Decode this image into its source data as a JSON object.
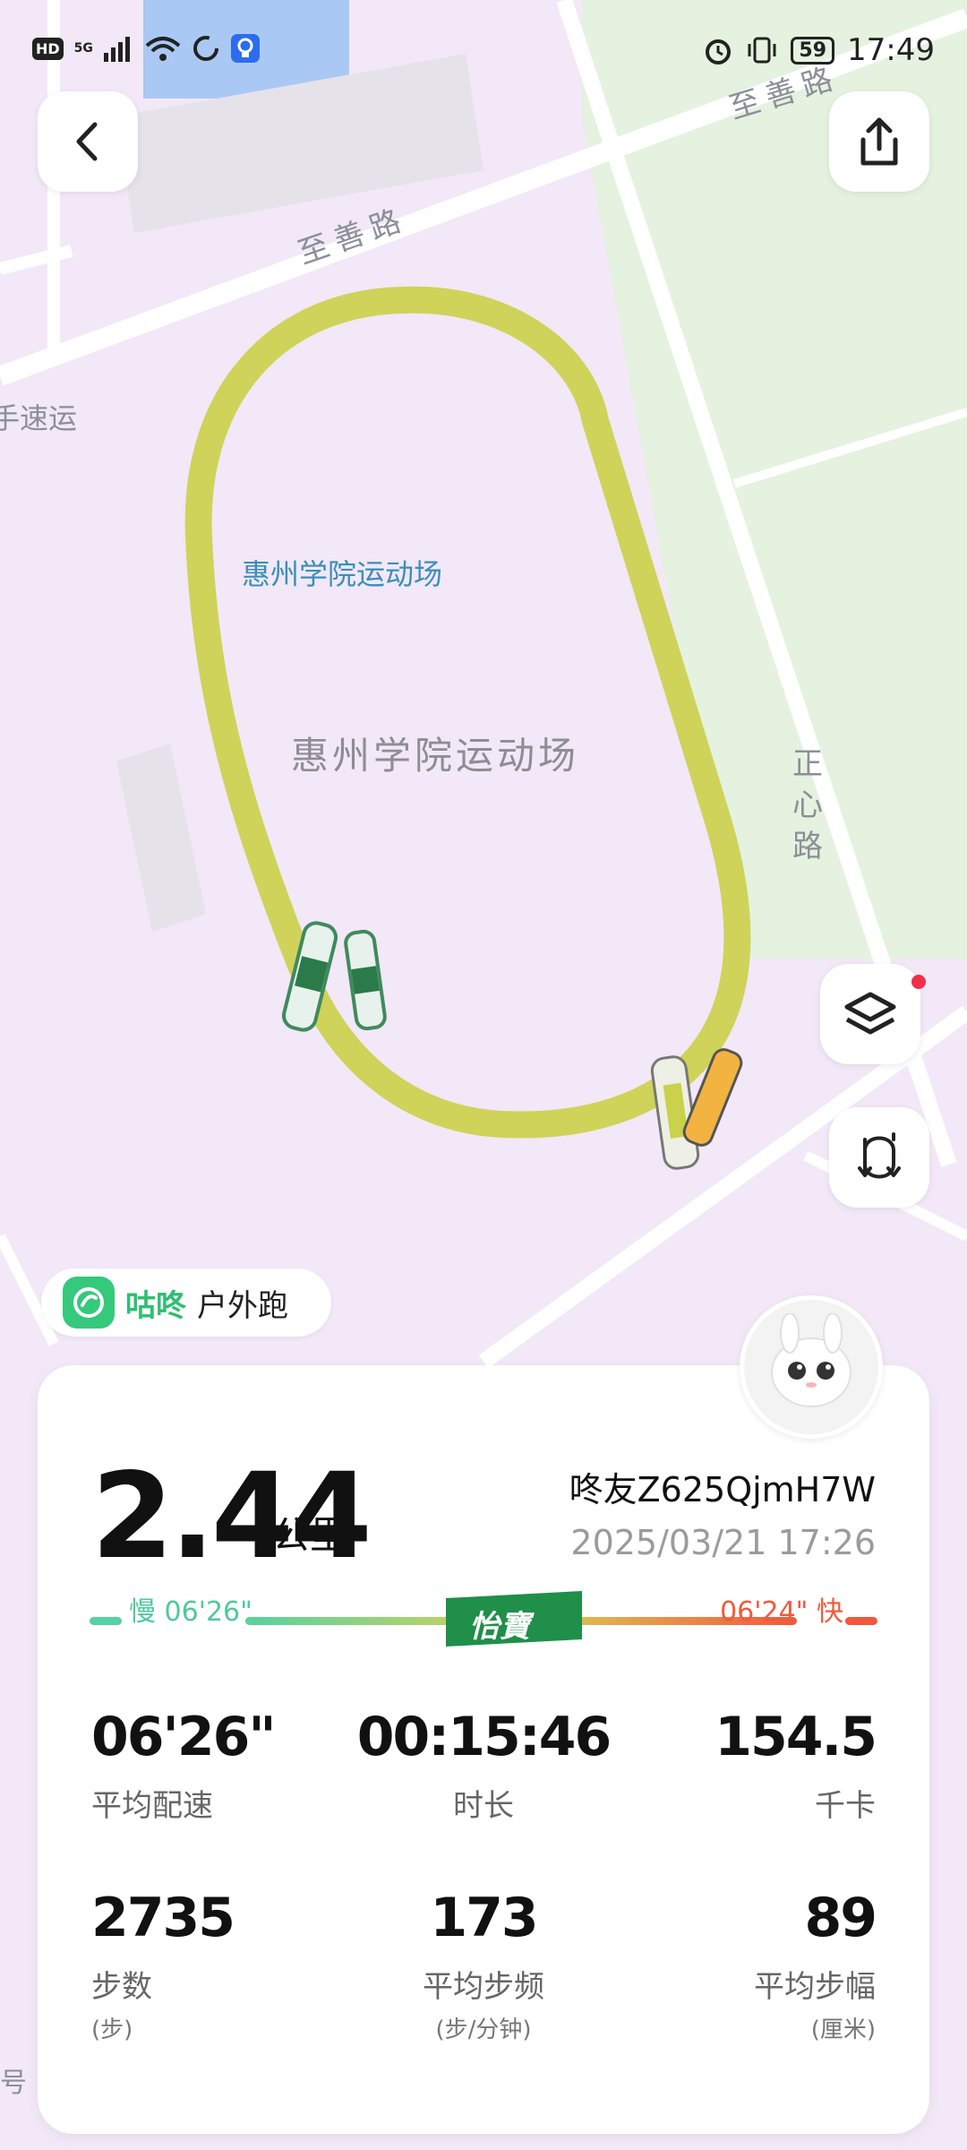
{
  "status_bar": {
    "network": "5G",
    "battery": "59",
    "time": "17:49"
  },
  "map": {
    "road_labels": [
      "至善路",
      "至善路",
      "正心路",
      "手速运",
      "号"
    ],
    "poi_label": "惠州学院运动场",
    "area_label": "惠州学院运动场",
    "route_color": "#cfd35a"
  },
  "brand": {
    "name": "咕咚",
    "activity": "户外跑"
  },
  "card": {
    "distance": "2.44",
    "distance_unit": "公里",
    "user": "咚友Z625QjmH7W",
    "datetime": "2025/03/21 17:26",
    "pace_slow": "慢 06'26\"",
    "pace_fast": "06'24\" 快",
    "sponsor": "怡寶",
    "stats": [
      {
        "value": "06'26\"",
        "label": "平均配速",
        "sub": ""
      },
      {
        "value": "00:15:46",
        "label": "时长",
        "sub": ""
      },
      {
        "value": "154.5",
        "label": "千卡",
        "sub": ""
      },
      {
        "value": "2735",
        "label": "步数",
        "sub": "(步)"
      },
      {
        "value": "173",
        "label": "平均步频",
        "sub": "(步/分钟)"
      },
      {
        "value": "89",
        "label": "平均步幅",
        "sub": "(厘米)"
      }
    ]
  },
  "icons": [
    "back-icon",
    "share-icon",
    "layers-icon",
    "route-icon"
  ],
  "colors": {
    "brand_green": "#2fbf73",
    "pace_slow": "#4fc99c",
    "pace_fast": "#f05a3e",
    "route": "#cfd35a"
  }
}
